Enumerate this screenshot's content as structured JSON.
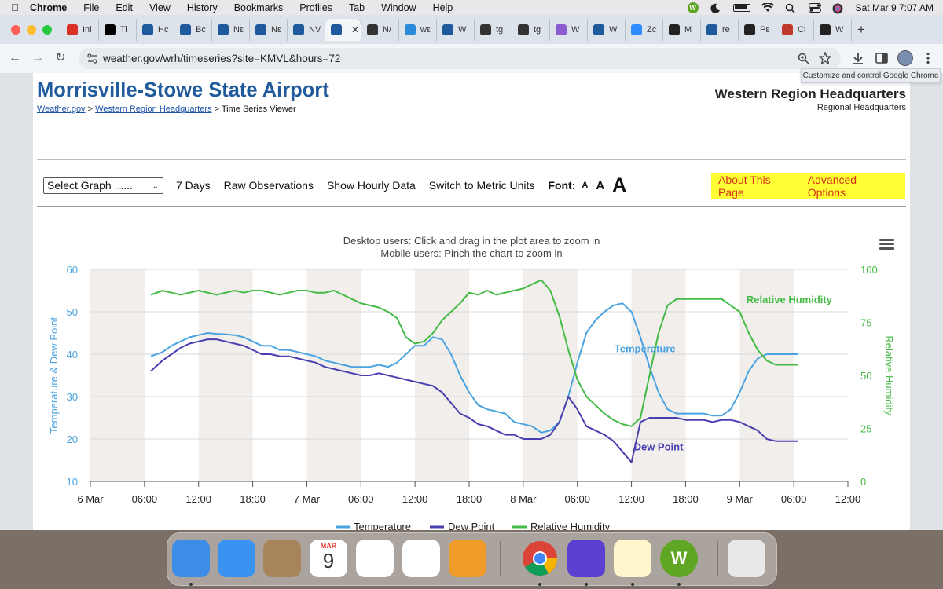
{
  "menubar": {
    "app": "Chrome",
    "items": [
      "File",
      "Edit",
      "View",
      "History",
      "Bookmarks",
      "Profiles",
      "Tab",
      "Window",
      "Help"
    ],
    "datetime": "Sat Mar 9  7:07 AM"
  },
  "tabs": [
    {
      "label": "Inl",
      "icon": "gmail-icon",
      "color": "#d93025"
    },
    {
      "label": "Ti",
      "icon": "x-icon",
      "color": "#000000"
    },
    {
      "label": "Hc",
      "icon": "noaa-icon",
      "color": "#1f5a9c"
    },
    {
      "label": "Bc",
      "icon": "noaa-icon",
      "color": "#1f5a9c"
    },
    {
      "label": "Nε",
      "icon": "noaa-icon",
      "color": "#1f5a9c"
    },
    {
      "label": "Nε",
      "icon": "noaa-icon",
      "color": "#1f5a9c"
    },
    {
      "label": "NV",
      "icon": "noaa-icon",
      "color": "#1f5a9c"
    },
    {
      "label": "",
      "icon": "noaa-icon",
      "color": "#1f5a9c",
      "active": true
    },
    {
      "label": "N/",
      "icon": "globe-icon",
      "color": "#333333"
    },
    {
      "label": "wε",
      "icon": "weather-icon",
      "color": "#2b8bd8"
    },
    {
      "label": "W",
      "icon": "noaa-icon",
      "color": "#1f5a9c"
    },
    {
      "label": "tg",
      "icon": "github-icon",
      "color": "#333333"
    },
    {
      "label": "tg",
      "icon": "github-icon",
      "color": "#333333"
    },
    {
      "label": "W",
      "icon": "sparkle-icon",
      "color": "#8a5cd0"
    },
    {
      "label": "W",
      "icon": "noaa-icon",
      "color": "#1f5a9c"
    },
    {
      "label": "Zc",
      "icon": "zoom-icon",
      "color": "#2d8cff"
    },
    {
      "label": "M",
      "icon": "openai-icon",
      "color": "#222222"
    },
    {
      "label": "re",
      "icon": "noaa-icon",
      "color": "#1f5a9c"
    },
    {
      "label": "Pε",
      "icon": "wikipedia-icon",
      "color": "#222222"
    },
    {
      "label": "Cl",
      "icon": "calendar-icon",
      "color": "#c0392b"
    },
    {
      "label": "W",
      "icon": "openai-icon",
      "color": "#222222"
    }
  ],
  "browser": {
    "url": "weather.gov/wrh/timeseries?site=KMVL&hours=72",
    "tooltip": "Customize and control Google Chrome"
  },
  "header": {
    "title": "Morrisville-Stowe State Airport",
    "breadcrumb": [
      "Weather.gov",
      "Western Region Headquarters",
      "Time Series Viewer"
    ],
    "breadcrumb_sep": ">",
    "org_title": "Western Region Headquarters",
    "org_subtitle": "Regional Headquarters"
  },
  "controls": {
    "select_graph": "Select Graph ......",
    "links": [
      "7 Days",
      "Raw Observations",
      "Show Hourly Data",
      "Switch to Metric Units"
    ],
    "font_label": "Font:",
    "font_sizes": [
      "A",
      "A",
      "A"
    ],
    "about": "About This Page",
    "advanced": "Advanced Options"
  },
  "chart_notes": {
    "line1": "Desktop users: Click and drag in the plot area to zoom in",
    "line2": "Mobile users: Pinch the chart to zoom in"
  },
  "chart_data": {
    "type": "line",
    "xlabel": "",
    "ylabel": "Temperature & Dew Point",
    "y2label": "Relative Humidity",
    "ylim": [
      10,
      60
    ],
    "y2lim": [
      0,
      100
    ],
    "yticks": [
      "10",
      "20",
      "30",
      "40",
      "50",
      "60"
    ],
    "y2ticks": [
      "0",
      "25",
      "50",
      "75",
      "100"
    ],
    "xlim_hours": [
      0,
      84
    ],
    "xticks": [
      "6 Mar",
      "06:00",
      "12:00",
      "18:00",
      "7 Mar",
      "06:00",
      "12:00",
      "18:00",
      "8 Mar",
      "06:00",
      "12:00",
      "18:00",
      "9 Mar",
      "06:00",
      "12:00"
    ],
    "legend_position": "bottom",
    "colors": {
      "temperature": "#4aa3e0",
      "dewpoint": "#4a3fb0",
      "humidity": "#44bb44",
      "tick": "#4aa3e0"
    },
    "series": [
      {
        "name": "Temperature",
        "axis": "left",
        "x": [
          6.7,
          8,
          9,
          10,
          11,
          12,
          13,
          14,
          15,
          16,
          17,
          18,
          19,
          20,
          21,
          22,
          23,
          24,
          25,
          26,
          27,
          28,
          29,
          30,
          31,
          32,
          33,
          34,
          35,
          36,
          37,
          38,
          39,
          40,
          41,
          42,
          43,
          44,
          45,
          46,
          47,
          48,
          49,
          50,
          51,
          52,
          53,
          54,
          55,
          56,
          57,
          58,
          59,
          60,
          61,
          62,
          63,
          64,
          65,
          66,
          67,
          68,
          69,
          70,
          71,
          72,
          73,
          74,
          75,
          76,
          77,
          78,
          78.5
        ],
        "values": [
          39.5,
          40.5,
          42,
          43,
          44,
          44.5,
          45,
          44.8,
          44.7,
          44.5,
          44,
          43,
          42,
          42,
          41,
          41,
          40.5,
          40,
          39.5,
          38.5,
          38,
          37.5,
          37,
          37,
          37,
          37.5,
          37,
          38,
          40,
          42,
          42,
          44,
          43.5,
          40,
          35,
          31,
          28,
          27,
          26.5,
          26,
          24,
          23.5,
          23,
          21.5,
          22,
          24,
          30,
          38,
          45,
          48,
          50,
          51.5,
          52,
          50,
          44,
          37,
          31,
          27,
          26,
          26,
          26,
          26,
          25.5,
          25.5,
          27,
          31,
          36,
          39,
          40,
          40,
          40,
          40,
          40
        ]
      },
      {
        "name": "Dew Point",
        "axis": "left",
        "x": [
          6.7,
          8,
          9,
          10,
          11,
          12,
          13,
          14,
          15,
          16,
          17,
          18,
          19,
          20,
          21,
          22,
          23,
          24,
          25,
          26,
          27,
          28,
          29,
          30,
          31,
          32,
          33,
          34,
          35,
          36,
          37,
          38,
          39,
          40,
          41,
          42,
          43,
          44,
          45,
          46,
          47,
          48,
          49,
          50,
          51,
          52,
          53,
          54,
          55,
          56,
          57,
          58,
          59,
          60,
          61,
          62,
          63,
          64,
          65,
          66,
          67,
          68,
          69,
          70,
          71,
          72,
          73,
          74,
          75,
          76,
          77,
          78,
          78.5
        ],
        "values": [
          36,
          38.5,
          40,
          41.5,
          42.5,
          43,
          43.5,
          43.5,
          43,
          42.5,
          42,
          41,
          40,
          40,
          39.5,
          39.5,
          39,
          38.5,
          38,
          37,
          36.5,
          36,
          35.5,
          35,
          35,
          35.5,
          35,
          34.5,
          34,
          33.5,
          33,
          32.5,
          31,
          28.5,
          26,
          25,
          23.5,
          23,
          22,
          21,
          21,
          20,
          20,
          20,
          21,
          24,
          30,
          27,
          23,
          22,
          21,
          19.5,
          17,
          14.5,
          24,
          25,
          25,
          25,
          25,
          24.5,
          24.5,
          24.5,
          24,
          24.5,
          24.5,
          24,
          23,
          22,
          20,
          19.5,
          19.5,
          19.5,
          19.5
        ]
      },
      {
        "name": "Relative Humidity",
        "axis": "right",
        "x": [
          6.7,
          8,
          9,
          10,
          11,
          12,
          13,
          14,
          15,
          16,
          17,
          18,
          19,
          20,
          21,
          22,
          23,
          24,
          25,
          26,
          27,
          28,
          29,
          30,
          31,
          32,
          33,
          34,
          35,
          36,
          37,
          38,
          39,
          40,
          41,
          42,
          43,
          44,
          45,
          46,
          47,
          48,
          49,
          50,
          51,
          52,
          53,
          54,
          55,
          56,
          57,
          58,
          59,
          60,
          61,
          62,
          63,
          64,
          65,
          66,
          67,
          68,
          69,
          70,
          71,
          72,
          73,
          74,
          75,
          76,
          77,
          78,
          78.5
        ],
        "values": [
          88,
          90,
          89,
          88,
          89,
          90,
          89,
          88,
          89,
          90,
          89,
          90,
          90,
          89,
          88,
          89,
          90,
          90,
          89,
          89,
          90,
          88,
          86,
          84,
          83,
          82,
          80,
          77,
          68,
          65,
          66,
          70,
          76,
          80,
          84,
          89,
          88,
          90,
          88,
          89,
          90,
          91,
          93,
          95,
          90,
          78,
          62,
          48,
          40,
          36,
          32,
          29,
          27,
          26,
          30,
          50,
          70,
          83,
          86,
          86,
          86,
          86,
          86,
          86,
          83,
          80,
          70,
          62,
          57,
          55,
          55,
          55,
          55
        ]
      }
    ],
    "series_labels": [
      "Temperature",
      "Dew Point",
      "Relative Humidity"
    ]
  },
  "dock": [
    {
      "name": "finder-icon",
      "color": "#3d8de6",
      "running": true
    },
    {
      "name": "mail-icon",
      "color": "#3a93f0",
      "running": false
    },
    {
      "name": "contacts-icon",
      "color": "#a8845a",
      "running": false
    },
    {
      "name": "calendar-icon",
      "color": "#ffffff",
      "running": false
    },
    {
      "name": "freeform-icon",
      "color": "#ffffff",
      "running": false
    },
    {
      "name": "photos-icon",
      "color": "#ffffff",
      "running": false
    },
    {
      "name": "pages-icon",
      "color": "#f09b2a",
      "running": false
    },
    {
      "name": "chrome-icon",
      "color": "#ffffff",
      "running": true
    },
    {
      "name": "imovie-icon",
      "color": "#5a3fd0",
      "running": true
    },
    {
      "name": "notes-icon",
      "color": "#fff6cc",
      "running": true
    },
    {
      "name": "whatsapp-wheel-icon",
      "color": "#5ea623",
      "running": true
    },
    {
      "name": "trash-icon",
      "color": "#e8e8e8",
      "running": false
    }
  ],
  "dock_calendar": {
    "month": "MAR",
    "day": "9"
  }
}
